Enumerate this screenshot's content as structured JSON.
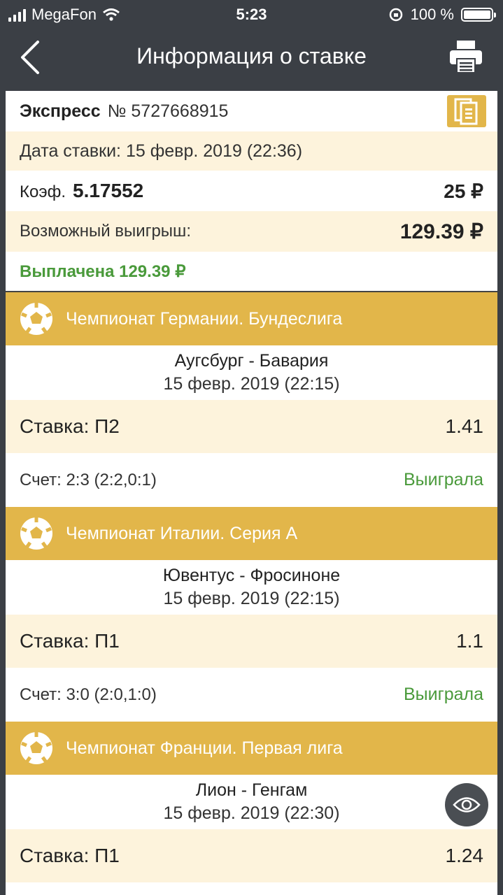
{
  "status_bar": {
    "carrier": "MegaFon",
    "time": "5:23",
    "battery": "100 %"
  },
  "nav": {
    "title": "Информация о ставке"
  },
  "bet": {
    "type": "Экспресс",
    "number": "№ 5727668915",
    "date": "Дата ставки: 15 февр. 2019 (22:36)",
    "coef_label": "Коэф.",
    "coef_value": "5.17552",
    "stake": "25 ₽",
    "possible_win_label": "Возможный выигрыш:",
    "possible_win_value": "129.39 ₽",
    "paid": "Выплачена 129.39 ₽"
  },
  "events": [
    {
      "league": "Чемпионат Германии. Бундеслига",
      "teams": "Аугсбург - Бавария",
      "date": "15 февр. 2019 (22:15)",
      "bet": "Ставка: П2",
      "odd": "1.41",
      "score": "Счет: 2:3 (2:2,0:1)",
      "result": "Выиграла"
    },
    {
      "league": "Чемпионат Италии. Серия А",
      "teams": "Ювентус - Фросиноне",
      "date": "15 февр. 2019 (22:15)",
      "bet": "Ставка: П1",
      "odd": "1.1",
      "score": "Счет: 3:0 (2:0,1:0)",
      "result": "Выиграла"
    },
    {
      "league": "Чемпионат Франции. Первая лига",
      "teams": "Лион - Генгам",
      "date": "15 февр. 2019 (22:30)",
      "bet": "Ставка: П1",
      "odd": "1.24"
    }
  ],
  "colors": {
    "accent": "#e2b64a",
    "cream": "#fdf3dc",
    "win_green": "#4a9a3b",
    "dark": "#3b3f45"
  },
  "icons": [
    "back-chevron-icon",
    "print-icon",
    "copy-icon",
    "soccer-ball-icon",
    "eye-icon"
  ]
}
